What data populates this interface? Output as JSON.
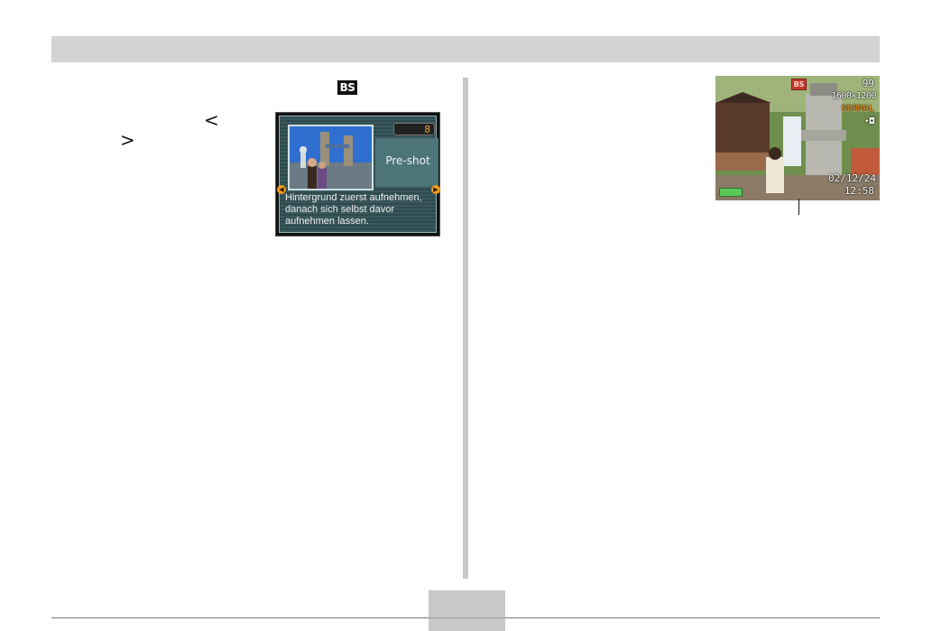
{
  "page": {
    "bs_icon_label": "BS",
    "angle_left": "<",
    "angle_right": ">"
  },
  "scene_screen": {
    "number": "8",
    "name": "Pre-shot",
    "description": [
      "Hintergrund zuerst aufnehmen,",
      "danach sich selbst davor",
      "aufnehmen lassen."
    ],
    "left_arrow": "◀",
    "right_arrow": "▶"
  },
  "live_screen": {
    "bs_label": "BS",
    "shots": "99",
    "resolution": "1600×1200",
    "quality": "NORMAL",
    "mode_icon": "camera-icon",
    "date": "02/12/24",
    "time": "12:58",
    "battery_icon": "battery-icon"
  },
  "colors": {
    "header_bar": "#d3d3d3",
    "orange_accent": "#f59b1c",
    "teal_panel": "#39585d"
  }
}
